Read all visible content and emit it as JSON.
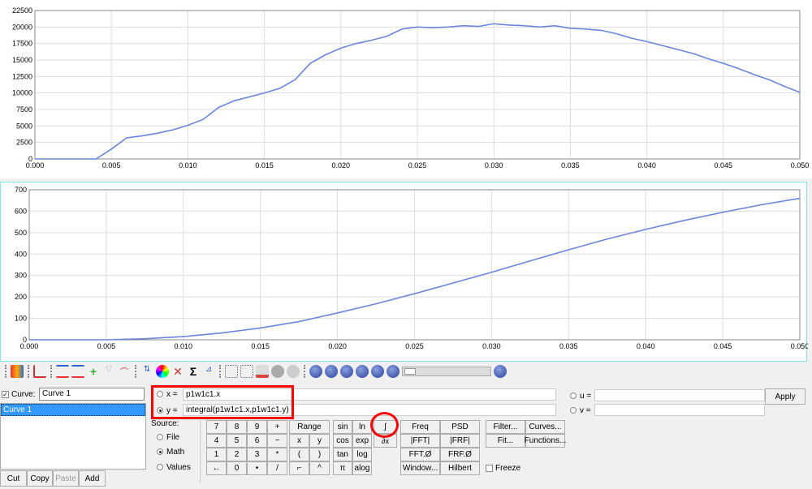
{
  "chart_data": [
    {
      "type": "line",
      "xlim": [
        0,
        0.05
      ],
      "ylim": [
        0,
        22500
      ],
      "grid": true,
      "xticks": [
        "0.000",
        "0.005",
        "0.010",
        "0.015",
        "0.020",
        "0.025",
        "0.030",
        "0.035",
        "0.040",
        "0.045",
        "0.050"
      ],
      "yticks": [
        "0",
        "2500",
        "5000",
        "7500",
        "10000",
        "12500",
        "15000",
        "17500",
        "20000",
        "22500"
      ],
      "x": [
        0,
        0.004,
        0.005,
        0.006,
        0.007,
        0.008,
        0.009,
        0.01,
        0.011,
        0.012,
        0.013,
        0.014,
        0.015,
        0.016,
        0.017,
        0.018,
        0.019,
        0.02,
        0.021,
        0.022,
        0.023,
        0.024,
        0.025,
        0.026,
        0.027,
        0.028,
        0.029,
        0.03,
        0.031,
        0.032,
        0.033,
        0.034,
        0.035,
        0.036,
        0.037,
        0.038,
        0.039,
        0.04,
        0.041,
        0.042,
        0.043,
        0.044,
        0.045,
        0.046,
        0.047,
        0.048,
        0.049,
        0.05
      ],
      "y": [
        0,
        0,
        1500,
        3200,
        3500,
        3900,
        4400,
        5100,
        6000,
        7800,
        8800,
        9400,
        10000,
        10700,
        12000,
        14500,
        15800,
        16800,
        17500,
        18000,
        18600,
        19700,
        20000,
        19900,
        20000,
        20200,
        20100,
        20500,
        20300,
        20200,
        20000,
        20200,
        19800,
        19700,
        19500,
        19000,
        18300,
        17800,
        17200,
        16600,
        16000,
        15200,
        14500,
        13700,
        12800,
        12000,
        11000,
        10100
      ],
      "color": "#6b86d9"
    },
    {
      "type": "line",
      "xlim": [
        0,
        0.05
      ],
      "ylim": [
        0,
        700
      ],
      "grid": true,
      "xticks": [
        "0.000",
        "0.005",
        "0.010",
        "0.015",
        "0.020",
        "0.025",
        "0.030",
        "0.035",
        "0.040",
        "0.045",
        "0.050"
      ],
      "yticks": [
        "0",
        "100",
        "200",
        "300",
        "400",
        "500",
        "600",
        "700"
      ],
      "x": [
        0,
        0.005,
        0.0075,
        0.01,
        0.0125,
        0.015,
        0.0175,
        0.02,
        0.0225,
        0.025,
        0.0275,
        0.03,
        0.0325,
        0.035,
        0.0375,
        0.04,
        0.0425,
        0.045,
        0.0475,
        0.05
      ],
      "y": [
        0,
        0,
        5,
        15,
        32,
        55,
        85,
        125,
        168,
        215,
        265,
        315,
        368,
        420,
        470,
        515,
        557,
        595,
        630,
        660
      ],
      "color": "#6b86d9"
    }
  ],
  "curve_panel": {
    "checkbox_label": "Curve:",
    "curve_name": "Curve 1",
    "list": [
      "Curve 1"
    ],
    "buttons": [
      "Cut",
      "Copy",
      "Paste",
      "Add"
    ]
  },
  "expr": {
    "x_label": "x =",
    "x_value": "p1w1c1.x",
    "y_label": "y =",
    "y_value": "integral(p1w1c1.x,p1w1c1.y)",
    "u_label": "u =",
    "v_label": "v =",
    "u_value": "",
    "v_value": "",
    "apply": "Apply"
  },
  "source": {
    "label": "Source:",
    "options": [
      "File",
      "Math",
      "Values"
    ],
    "selected": "Math"
  },
  "keypad": [
    [
      "7",
      "8",
      "9",
      "+"
    ],
    [
      "4",
      "5",
      "6",
      "−"
    ],
    [
      "1",
      "2",
      "3",
      "*"
    ],
    [
      "←",
      "0",
      "•",
      "/"
    ]
  ],
  "ops": [
    [
      "Range"
    ],
    [
      "x",
      "y"
    ],
    [
      "(",
      ")"
    ],
    [
      "⌐",
      "^"
    ]
  ],
  "funcs": [
    [
      "sin",
      "ln"
    ],
    [
      "cos",
      "exp"
    ],
    [
      "tan",
      "log"
    ],
    [
      "π",
      "alog"
    ]
  ],
  "calc": {
    "integral": "∫",
    "derivative": "∂x"
  },
  "signal": [
    [
      "Freq",
      "PSD"
    ],
    [
      "|FFT|",
      "|FRF|"
    ],
    [
      "FFT.Ø",
      "FRF.Ø"
    ],
    [
      "Window...",
      "Hilbert"
    ]
  ],
  "tools": [
    [
      "Filter...",
      "Curves..."
    ],
    [
      "Fit...",
      "Functions..."
    ]
  ],
  "freeze": "Freeze"
}
